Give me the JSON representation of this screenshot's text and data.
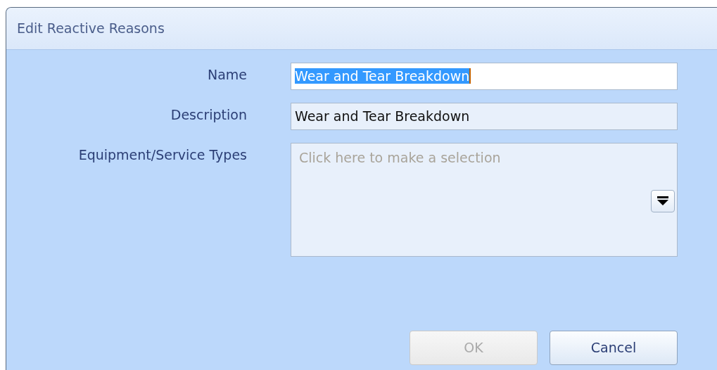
{
  "window": {
    "title": "Edit Reactive Reasons"
  },
  "fields": [
    {
      "kind": "text",
      "label": "Name",
      "value": "Wear and Tear Breakdown",
      "focused": true
    },
    {
      "kind": "text",
      "label": "Description",
      "value": "Wear and Tear Breakdown",
      "focused": false
    },
    {
      "kind": "multiselect",
      "label": "Equipment/Service Types",
      "placeholder": "Click here to make a selection",
      "focused": false
    }
  ],
  "buttons": [
    {
      "label": "OK",
      "disabled": true
    },
    {
      "label": "Cancel",
      "disabled": false
    }
  ]
}
